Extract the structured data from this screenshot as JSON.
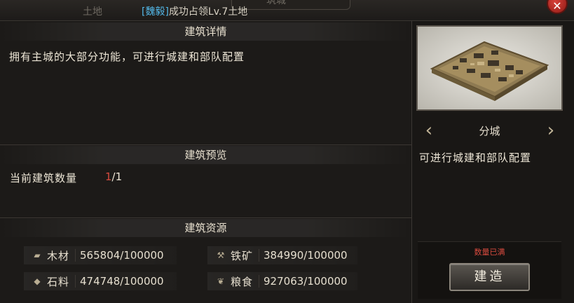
{
  "topbar": {
    "faded_left": "土地",
    "faded_mid": "筑城",
    "notice_tag": "[魏毅]",
    "notice_text": "成功占领Lv.7土地",
    "close": "✕"
  },
  "details": {
    "header": "建筑详情",
    "description": "拥有主城的大部分功能，可进行城建和部队配置"
  },
  "preview": {
    "header": "建筑预览",
    "count_label": "当前建筑数量",
    "count_current": "1",
    "count_sep_max": "/1"
  },
  "resources": {
    "header": "建筑资源",
    "items": [
      {
        "icon": "wood-icon",
        "name": "木材",
        "value": "565804/100000"
      },
      {
        "icon": "iron-icon",
        "name": "铁矿",
        "value": "384990/100000"
      },
      {
        "icon": "stone-icon",
        "name": "石料",
        "value": "474748/100000"
      },
      {
        "icon": "grain-icon",
        "name": "粮食",
        "value": "927063/100000"
      }
    ]
  },
  "side": {
    "city_name": "分城",
    "description": "可进行城建和部队配置",
    "full_label": "数量已满",
    "build_label": "建造"
  }
}
